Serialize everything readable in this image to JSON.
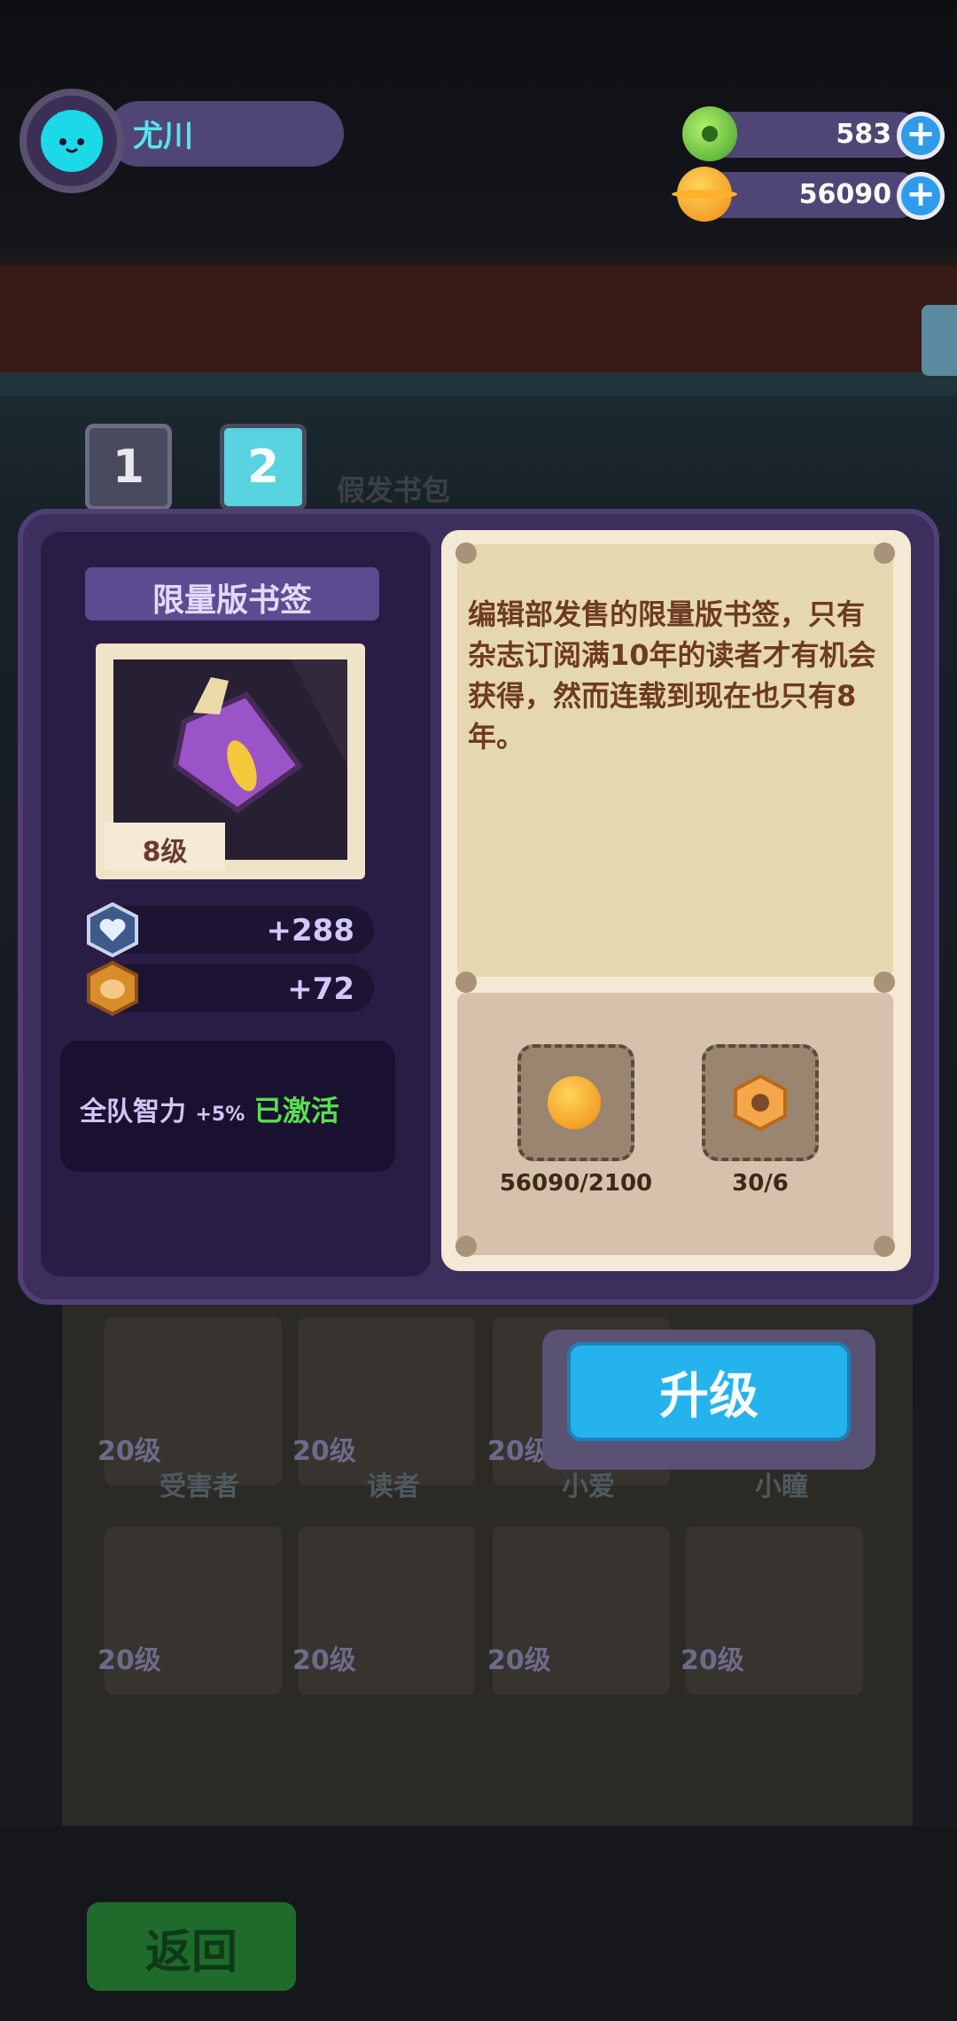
{
  "player": {
    "name": "尤川"
  },
  "resources": {
    "gems": "583",
    "coins": "56090"
  },
  "tabs": [
    {
      "label": "1",
      "active": false
    },
    {
      "label": "2",
      "active": true
    }
  ],
  "background": {
    "bubble_text": "假发书包",
    "back_button": "返回",
    "cards": [
      {
        "level": "20级",
        "name": "受害者"
      },
      {
        "level": "20级",
        "name": "读者"
      },
      {
        "level": "20级",
        "name": "小爱"
      },
      {
        "level": "",
        "name": "小瞳"
      },
      {
        "level": "20级",
        "name": ""
      },
      {
        "level": "20级",
        "name": ""
      },
      {
        "level": "20级",
        "name": ""
      },
      {
        "level": "20级",
        "name": ""
      }
    ]
  },
  "item": {
    "title": "限量版书签",
    "level": "8级",
    "stats": [
      {
        "icon": "heart-shield-icon",
        "value": "+288"
      },
      {
        "icon": "brain-badge-icon",
        "value": "+72"
      }
    ],
    "skill": {
      "name": "全队智力",
      "bonus": "+5%",
      "status": "已激活"
    },
    "description": "编辑部发售的限量版书签，只有杂志订阅满10年的读者才有机会获得，然而连载到现在也只有8年。"
  },
  "upgrade": {
    "costs": [
      {
        "icon": "coin-icon",
        "amount": "56090/2100"
      },
      {
        "icon": "hex-nut-icon",
        "amount": "30/6"
      }
    ],
    "button_label": "升级"
  },
  "colors": {
    "panel": "#3c2e5d",
    "accent_cyan": "#1bd9e6",
    "upgrade_blue": "#25b3ee",
    "active_green": "#57e04c"
  }
}
